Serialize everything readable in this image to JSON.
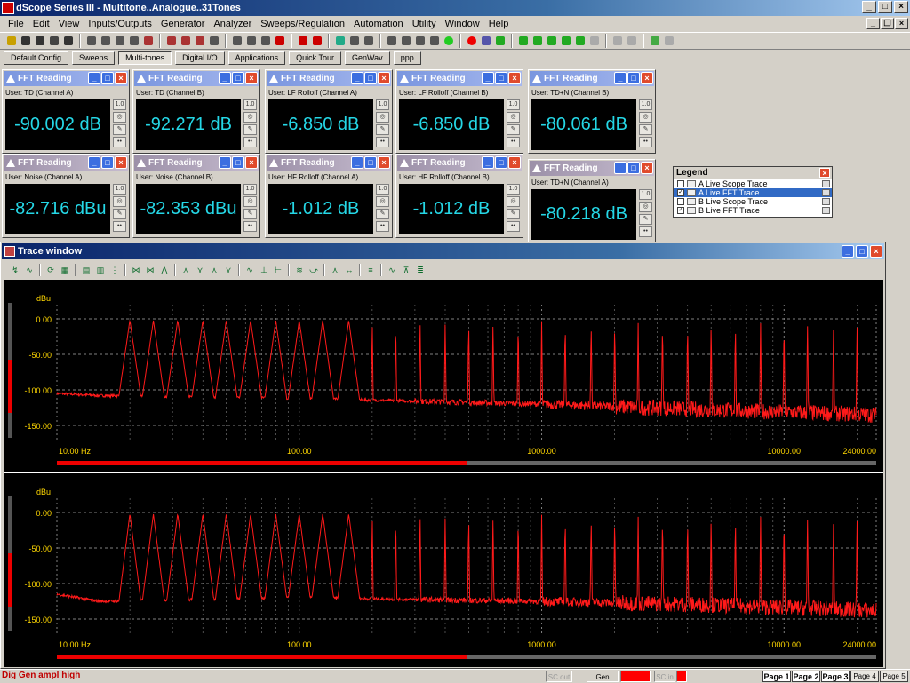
{
  "window": {
    "title": "dScope Series III - Multitone..Analogue..31Tones",
    "side_text": "닫기"
  },
  "menu": [
    "File",
    "Edit",
    "View",
    "Inputs/Outputs",
    "Generator",
    "Analyzer",
    "Sweeps/Regulation",
    "Automation",
    "Utility",
    "Window",
    "Help"
  ],
  "tabs": [
    "Default Config",
    "Sweeps",
    "Multi-tones",
    "Digital I/O",
    "Applications",
    "Quick Tour",
    "GenWav",
    "ppp"
  ],
  "active_tab": "Multi-tones",
  "fft_panels": [
    {
      "title": "FFT Reading",
      "label": "User: TD (Channel A)",
      "value": "-90.002 dB"
    },
    {
      "title": "FFT Reading",
      "label": "User: TD (Channel B)",
      "value": "-92.271 dB"
    },
    {
      "title": "FFT Reading",
      "label": "User: LF Rolloff (Channel A)",
      "value": "-6.850 dB"
    },
    {
      "title": "FFT Reading",
      "label": "User: LF Rolloff (Channel B)",
      "value": "-6.850 dB"
    },
    {
      "title": "FFT Reading",
      "label": "User: TD+N (Channel B)",
      "value": "-80.061 dB"
    },
    {
      "title": "FFT Reading",
      "label": "User: Noise (Channel A)",
      "value": "-82.716 dBu"
    },
    {
      "title": "FFT Reading",
      "label": "User: Noise (Channel B)",
      "value": "-82.353 dBu"
    },
    {
      "title": "FFT Reading",
      "label": "User: HF Rolloff (Channel A)",
      "value": "-1.012 dB"
    },
    {
      "title": "FFT Reading",
      "label": "User: HF Rolloff (Channel B)",
      "value": "-1.012 dB"
    },
    {
      "title": "FFT Reading",
      "label": "User: TD+N (Channel A)",
      "value": "-80.218 dB"
    }
  ],
  "fft_side_button": "1.0",
  "legend": {
    "title": "Legend",
    "items": [
      {
        "label": "A Live Scope Trace",
        "checked": false,
        "selected": false
      },
      {
        "label": "A Live FFT Trace",
        "checked": true,
        "selected": true
      },
      {
        "label": "B Live Scope Trace",
        "checked": false,
        "selected": false
      },
      {
        "label": "B Live FFT Trace",
        "checked": true,
        "selected": false
      }
    ]
  },
  "trace_window": {
    "title": "Trace window"
  },
  "colors": {
    "trace": "#ff1a1a",
    "grid": "#808080",
    "panel_digits": "#25d7e6",
    "axis_text": "#ffd700"
  },
  "chart_data": [
    {
      "type": "line",
      "ylabel": "dBu",
      "y_ticks": [
        "0.00",
        "-50.00",
        "-100.00",
        "-150.00"
      ],
      "x_ticks": [
        "10.00 Hz",
        "100.00",
        "1000.00",
        "10000.00",
        "24000.00"
      ],
      "xscale": "log",
      "xlim": [
        10,
        24000
      ],
      "ylim": [
        -170,
        20
      ],
      "grid": true,
      "noise_floor": [
        [
          10,
          -105
        ],
        [
          15,
          -108
        ],
        [
          100,
          -112
        ],
        [
          1000,
          -120
        ],
        [
          5000,
          -128
        ],
        [
          24000,
          -135
        ]
      ],
      "tones_hz": [
        20,
        25,
        31.5,
        40,
        50,
        63,
        80,
        100,
        125,
        160,
        200,
        250,
        315,
        400,
        500,
        630,
        800,
        1000,
        1250,
        1600,
        2000,
        2500,
        3150,
        4000,
        5000,
        6300,
        8000,
        10000,
        12500,
        16000,
        20000
      ],
      "tone_level": -2
    },
    {
      "type": "line",
      "ylabel": "dBu",
      "y_ticks": [
        "0.00",
        "-50.00",
        "-100.00",
        "-150.00"
      ],
      "x_ticks": [
        "10.00 Hz",
        "100.00",
        "1000.00",
        "10000.00",
        "24000.00"
      ],
      "xscale": "log",
      "xlim": [
        10,
        24000
      ],
      "ylim": [
        -170,
        20
      ],
      "grid": true,
      "noise_floor": [
        [
          10,
          -115
        ],
        [
          15,
          -125
        ],
        [
          100,
          -120
        ],
        [
          1000,
          -125
        ],
        [
          5000,
          -130
        ],
        [
          24000,
          -138
        ]
      ],
      "tones_hz": [
        20,
        25,
        31.5,
        40,
        50,
        63,
        80,
        100,
        125,
        160,
        200,
        250,
        315,
        400,
        500,
        630,
        800,
        1000,
        1250,
        1600,
        2000,
        2500,
        3150,
        4000,
        5000,
        6300,
        8000,
        10000,
        12500,
        16000,
        20000
      ],
      "tone_level": -2
    }
  ],
  "status": {
    "message": "Dig Gen ampl high",
    "items": [
      "SC out",
      "Gen",
      "SC in"
    ],
    "pages": [
      "Page 1",
      "Page 2",
      "Page 3",
      "Page 4",
      "Page 5"
    ]
  }
}
